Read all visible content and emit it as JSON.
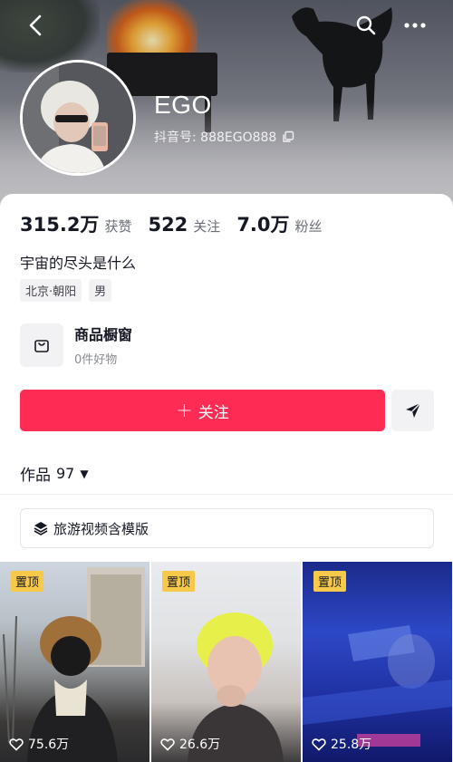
{
  "profile": {
    "nickname": "EGO",
    "douyin_id": "抖音号: 888EGO888"
  },
  "stats": [
    {
      "value": "315.2万",
      "label": "获赞"
    },
    {
      "value": "522",
      "label": "关注"
    },
    {
      "value": "7.0万",
      "label": "粉丝"
    }
  ],
  "bio": "宇宙的尽头是什么",
  "tags": [
    "北京·朝阳",
    "男"
  ],
  "shop": {
    "title": "商品橱窗",
    "subtitle": "0件好物"
  },
  "actions": {
    "follow_plus": "+",
    "follow_label": "关注"
  },
  "works": {
    "label": "作品",
    "count": "97",
    "caret": "▼"
  },
  "collection": {
    "label": "旅游视频含模版"
  },
  "videos": [
    {
      "pinned_label": "置顶",
      "likes": "75.6万"
    },
    {
      "pinned_label": "置顶",
      "likes": "26.6万"
    },
    {
      "pinned_label": "置顶",
      "likes": "25.8万"
    }
  ],
  "colors": {
    "accent": "#fe2c55",
    "pin_badge": "#f6c94a"
  },
  "icons": [
    "back-icon",
    "search-icon",
    "more-icon",
    "copy-icon",
    "shopping-bag-icon",
    "send-icon",
    "layers-icon",
    "heart-icon"
  ]
}
